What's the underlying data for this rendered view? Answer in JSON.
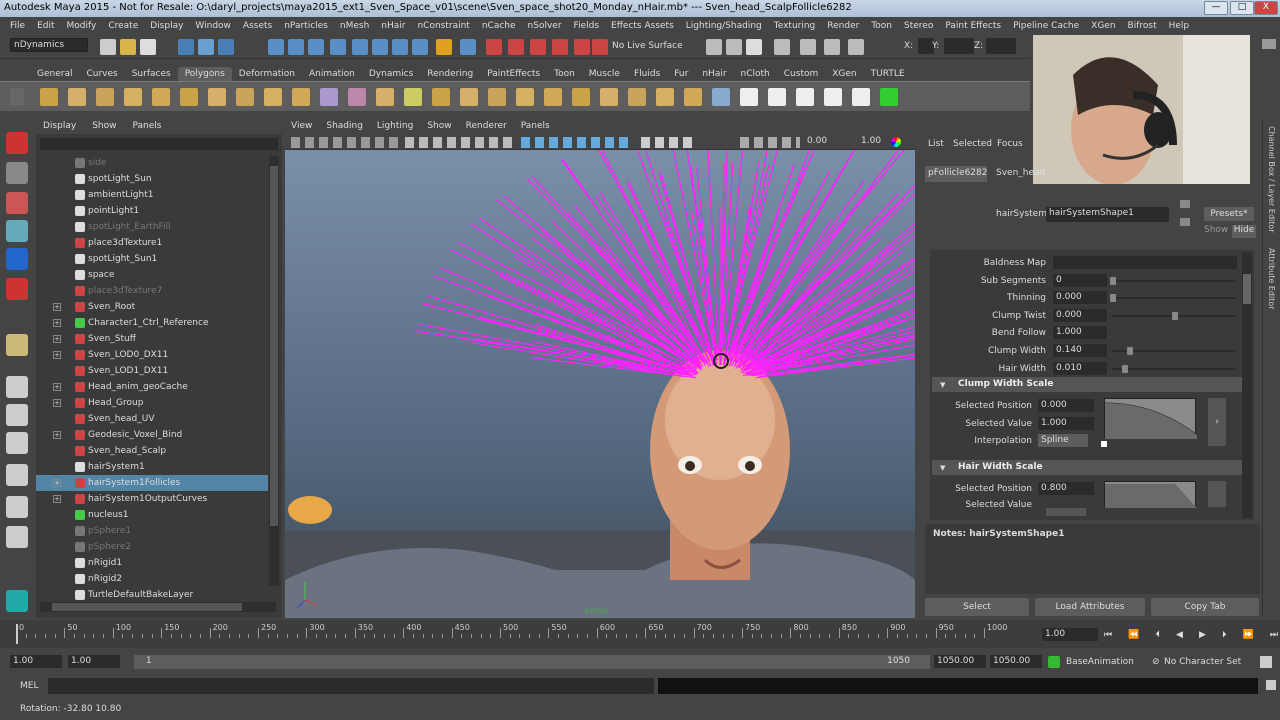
{
  "window": {
    "title": "Autodesk Maya 2015 - Not for Resale: O:\\daryl_projects\\maya2015_ext1_Sven_Space_v01\\scene\\Sven_space_shot20_Monday_nHair.mb*   ---   Sven_head_ScalpFollicle6282",
    "min": "—",
    "max": "□",
    "close": "X"
  },
  "menus": [
    "File",
    "Edit",
    "Modify",
    "Create",
    "Display",
    "Window",
    "Assets",
    "nParticles",
    "nMesh",
    "nHair",
    "nConstraint",
    "nCache",
    "nSolver",
    "Fields",
    "Effects Assets",
    "Lighting/Shading",
    "Texturing",
    "Render",
    "Toon",
    "Stereo",
    "Paint Effects",
    "Pipeline Cache",
    "XGen",
    "Bifrost",
    "Help"
  ],
  "statusline": {
    "mode": "nDynamics",
    "live_surface": "No Live Surface",
    "x_label": "X:",
    "y_label": "Y:",
    "z_label": "Z:"
  },
  "shelf_tabs": [
    "General",
    "Curves",
    "Surfaces",
    "Polygons",
    "Deformation",
    "Animation",
    "Dynamics",
    "Rendering",
    "PaintEffects",
    "Toon",
    "Muscle",
    "Fluids",
    "Fur",
    "nHair",
    "nCloth",
    "Custom",
    "XGen",
    "TURTLE"
  ],
  "shelf_active": "Polygons",
  "outliner": {
    "menu": [
      "Display",
      "Show",
      "Panels"
    ],
    "items": [
      {
        "label": "side",
        "dim": true,
        "exp": false,
        "color": "#777"
      },
      {
        "label": "spotLight_Sun",
        "dim": false,
        "exp": false,
        "color": "#ddd"
      },
      {
        "label": "ambientLight1",
        "dim": false,
        "exp": false,
        "color": "#ddd"
      },
      {
        "label": "pointLight1",
        "dim": false,
        "exp": false,
        "color": "#ddd"
      },
      {
        "label": "spotLight_EarthFill",
        "dim": true,
        "exp": false,
        "color": "#ddd"
      },
      {
        "label": "place3dTexture1",
        "dim": false,
        "exp": false,
        "color": "#c44"
      },
      {
        "label": "spotLight_Sun1",
        "dim": false,
        "exp": false,
        "color": "#ddd"
      },
      {
        "label": "space",
        "dim": false,
        "exp": false,
        "color": "#ddd"
      },
      {
        "label": "place3dTexture7",
        "dim": true,
        "exp": false,
        "color": "#c44"
      },
      {
        "label": "Sven_Root",
        "dim": false,
        "exp": true,
        "color": "#c44"
      },
      {
        "label": "Character1_Ctrl_Reference",
        "dim": false,
        "exp": true,
        "color": "#4c4"
      },
      {
        "label": "Sven_Stuff",
        "dim": false,
        "exp": true,
        "color": "#c44"
      },
      {
        "label": "Sven_LOD0_DX11",
        "dim": false,
        "exp": true,
        "color": "#c44"
      },
      {
        "label": "Sven_LOD1_DX11",
        "dim": false,
        "exp": false,
        "color": "#c44"
      },
      {
        "label": "Head_anim_geoCache",
        "dim": false,
        "exp": true,
        "color": "#c44"
      },
      {
        "label": "Head_Group",
        "dim": false,
        "exp": true,
        "color": "#c44"
      },
      {
        "label": "Sven_head_UV",
        "dim": false,
        "exp": false,
        "color": "#c44"
      },
      {
        "label": "Geodesic_Voxel_Bind",
        "dim": false,
        "exp": true,
        "color": "#c44"
      },
      {
        "label": "Sven_head_Scalp",
        "dim": false,
        "exp": false,
        "color": "#c44"
      },
      {
        "label": "hairSystem1",
        "dim": false,
        "exp": false,
        "color": "#ddd"
      },
      {
        "label": "hairSystem1Follicles",
        "dim": false,
        "exp": true,
        "color": "#c44",
        "sel": true
      },
      {
        "label": "hairSystem1OutputCurves",
        "dim": false,
        "exp": true,
        "color": "#c44"
      },
      {
        "label": "nucleus1",
        "dim": false,
        "exp": false,
        "color": "#4c4"
      },
      {
        "label": "pSphere1",
        "dim": true,
        "exp": false,
        "color": "#777"
      },
      {
        "label": "pSphere2",
        "dim": true,
        "exp": false,
        "color": "#777"
      },
      {
        "label": "nRigid1",
        "dim": false,
        "exp": false,
        "color": "#ddd"
      },
      {
        "label": "nRigid2",
        "dim": false,
        "exp": false,
        "color": "#ddd"
      },
      {
        "label": "TurtleDefaultBakeLayer",
        "dim": false,
        "exp": false,
        "color": "#ddd"
      }
    ]
  },
  "viewport": {
    "menu": [
      "View",
      "Shading",
      "Lighting",
      "Show",
      "Renderer",
      "Panels"
    ],
    "val1": "0.00",
    "val2": "1.00",
    "watermark": "persp"
  },
  "attr": {
    "tabs": [
      "List",
      "Selected",
      "Focus"
    ],
    "node_tabs": [
      "pFollicle6282",
      "Sven_head"
    ],
    "hairsystem_label": "hairSystem:",
    "hairsystem_value": "hairSystemShape1",
    "presets": "Presets*",
    "show": "Show",
    "hide": "Hide",
    "rows": [
      {
        "label": "Baldness Map",
        "value": ""
      },
      {
        "label": "Sub Segments",
        "value": "0",
        "slider": 0.0
      },
      {
        "label": "Thinning",
        "value": "0.000",
        "slider": 0.0
      },
      {
        "label": "Clump Twist",
        "value": "0.000",
        "slider": 0.5
      },
      {
        "label": "Bend Follow",
        "value": "1.000"
      },
      {
        "label": "Clump Width",
        "value": "0.140",
        "slider": 0.14
      },
      {
        "label": "Hair Width",
        "value": "0.010",
        "slider": 0.1
      }
    ],
    "clump_section": "Clump Width Scale",
    "clump": {
      "pos_label": "Selected Position",
      "pos": "0.000",
      "val_label": "Selected Value",
      "val": "1.000",
      "interp_label": "Interpolation",
      "interp": "Spline"
    },
    "hair_section": "Hair Width Scale",
    "hair": {
      "pos_label": "Selected Position",
      "pos": "0.800",
      "val_label": "Selected Value",
      "val": "1.000"
    },
    "notes": "Notes: hairSystemShape1",
    "buttons": [
      "Select",
      "Load Attributes",
      "Copy Tab"
    ]
  },
  "rail": {
    "channel_box": "Channel Box / Layer Editor",
    "attr_editor": "Attribute Editor"
  },
  "timeslider": {
    "ticks": [
      "0",
      "50",
      "100",
      "150",
      "200",
      "250",
      "300",
      "350",
      "400",
      "450",
      "500",
      "550",
      "600",
      "650",
      "700",
      "750",
      "800",
      "850",
      "900",
      "950",
      "1000"
    ],
    "current": "1.00"
  },
  "range": {
    "start": "1.00",
    "start2": "1.00",
    "inner_start": "1",
    "inner_end": "1050",
    "end": "1050.00",
    "end2": "1050.00",
    "anim_layer": "BaseAnimation",
    "char_set": "No Character Set"
  },
  "mel": {
    "label": "MEL"
  },
  "help": {
    "text": "Rotation:  -32.80    10.80"
  }
}
